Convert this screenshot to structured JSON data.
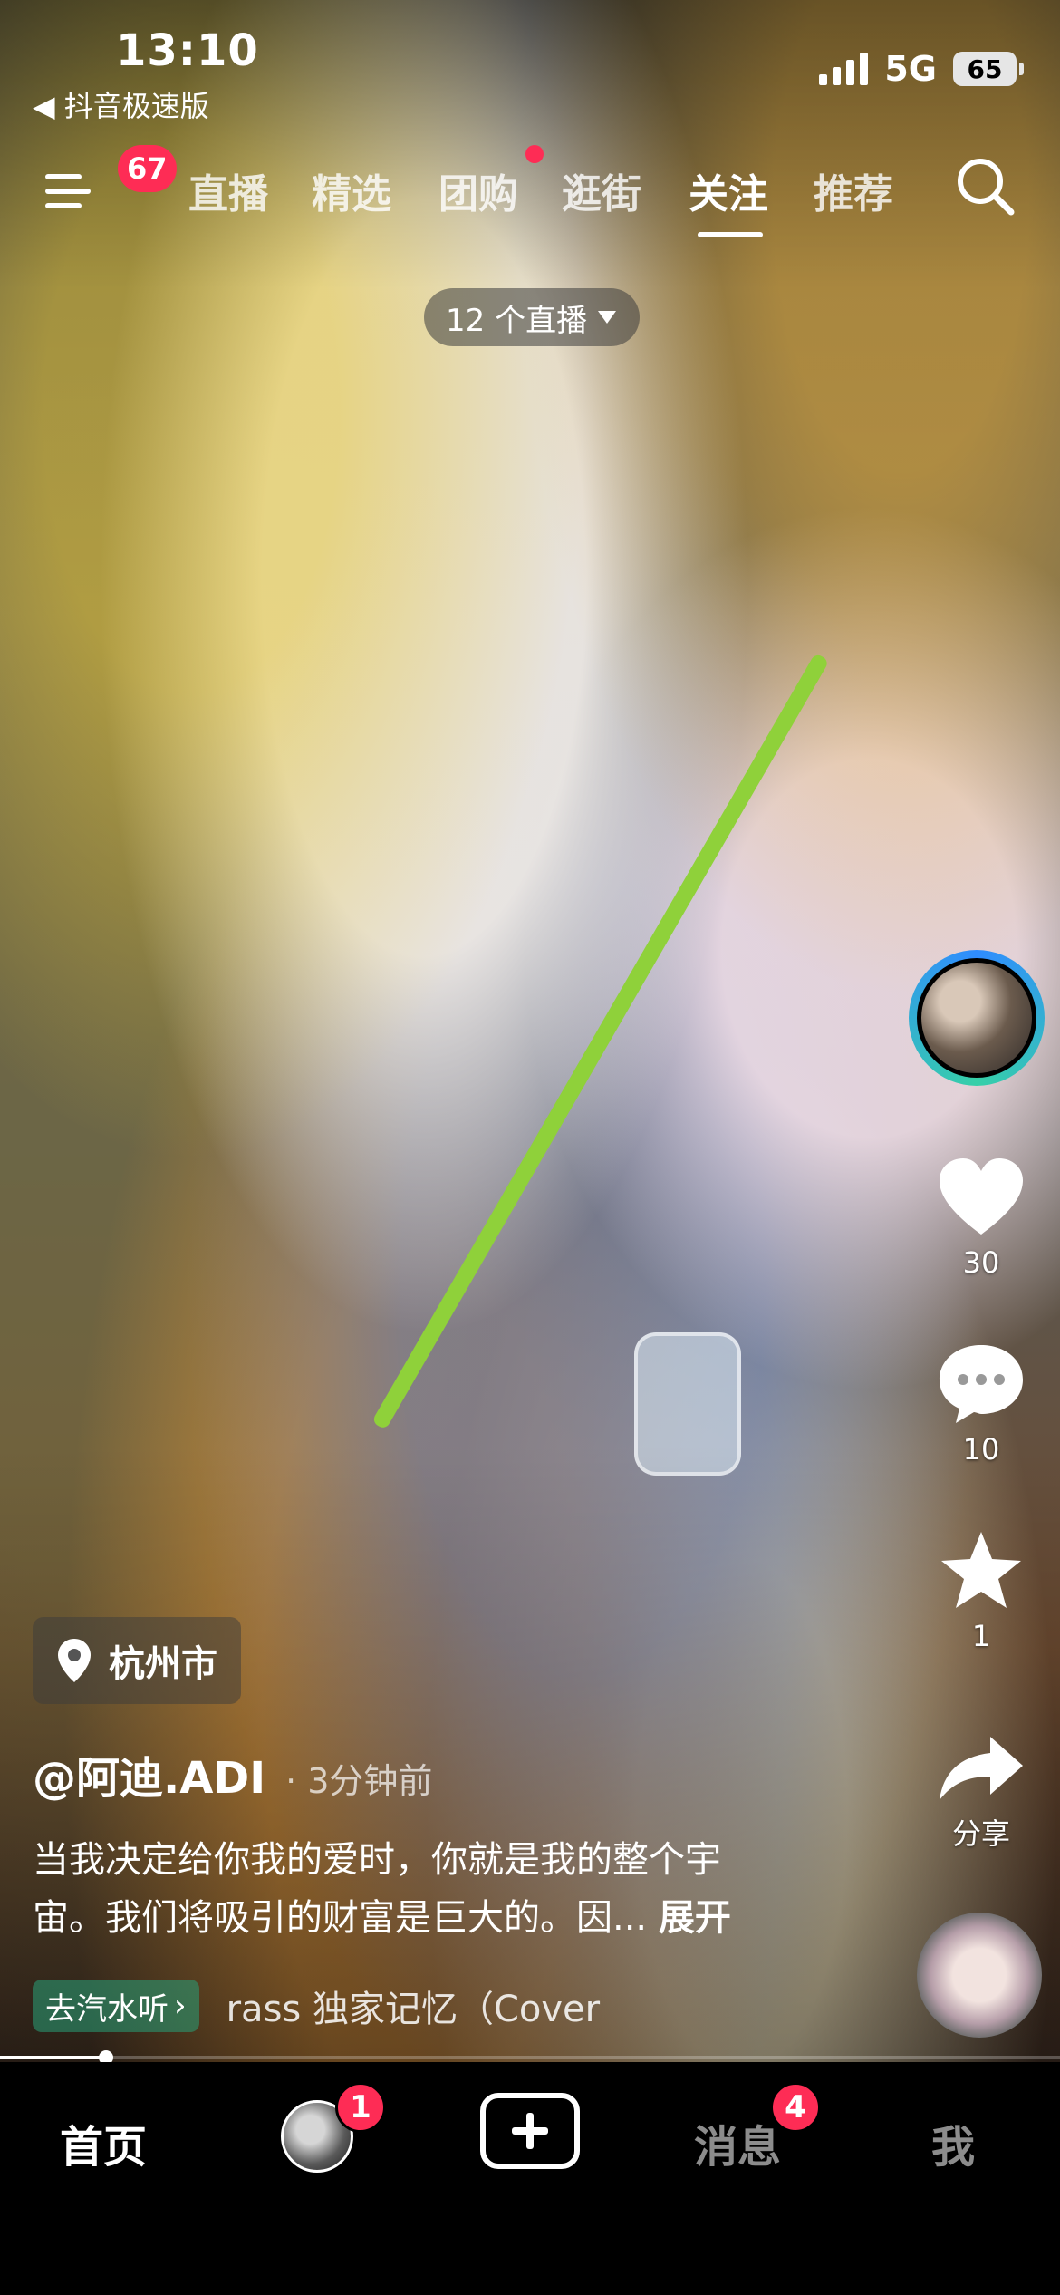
{
  "status_bar": {
    "time": "13:10",
    "back_app": "◀ 抖音极速版",
    "network": "5G",
    "battery": "65"
  },
  "top_nav": {
    "menu_badge": "67",
    "tabs": [
      {
        "label": "直播",
        "active": false
      },
      {
        "label": "精选",
        "active": false
      },
      {
        "label": "团购",
        "active": false,
        "dot": true
      },
      {
        "label": "逛街",
        "active": false
      },
      {
        "label": "关注",
        "active": true
      },
      {
        "label": "推荐",
        "active": false
      }
    ],
    "live_pill": "12 个直播"
  },
  "sidebar": {
    "like_count": "30",
    "comment_count": "10",
    "favorite_count": "1",
    "share_label": "分享"
  },
  "post": {
    "location": "杭州市",
    "author": "@阿迪.ADI",
    "time_ago": "· 3分钟前",
    "description_line1": "当我决定给你我的爱时，你就是我的整个宇",
    "description_line2": "宙。我们将吸引的财富是巨大的。因...",
    "expand_label": "展开",
    "music_chip": "去汽水听",
    "music_text": "rass    独家记忆（Cover",
    "progress": 0.1
  },
  "bottom_tabs": {
    "home": "首页",
    "friends_badge": "1",
    "messages": "消息",
    "messages_badge": "4",
    "me": "我"
  },
  "colors": {
    "badge_red": "#fe2c55",
    "background": "#000000"
  }
}
